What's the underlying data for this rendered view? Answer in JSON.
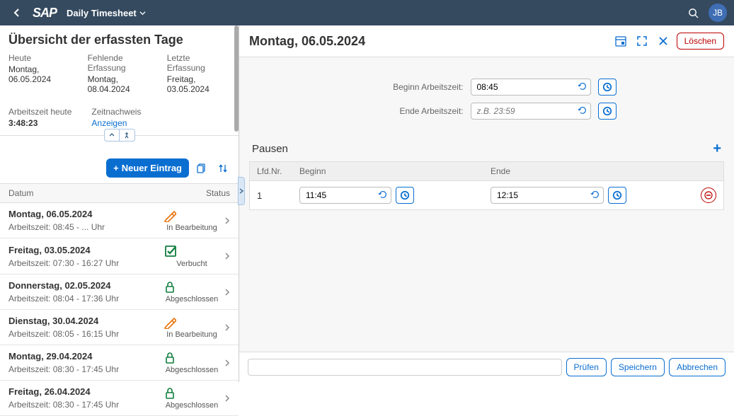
{
  "header": {
    "app_title": "Daily Timesheet",
    "avatar": "JB"
  },
  "overview": {
    "title": "Übersicht der erfassten Tage",
    "today_label": "Heute",
    "today_value": "Montag, 06.05.2024",
    "missing_label": "Fehlende Erfassung",
    "missing_value": "Montag, 08.04.2024",
    "last_label": "Letzte Erfassung",
    "last_value": "Freitag, 03.05.2024",
    "work_today_label": "Arbeitszeit heute",
    "work_today_value": "3:48:23",
    "proof_label": "Zeitnachweis",
    "proof_link": "Anzeigen"
  },
  "toolbar": {
    "new_entry": "Neuer Eintrag"
  },
  "list_header": {
    "date": "Datum",
    "status": "Status"
  },
  "status_labels": {
    "in_bearbeitung": "In Bearbeitung",
    "verbucht": "Verbucht",
    "abgeschlossen": "Abgeschlossen"
  },
  "entries": [
    {
      "date": "Montag, 06.05.2024",
      "sub": "Arbeitszeit: 08:45 - ... Uhr",
      "status": "in_bearbeitung"
    },
    {
      "date": "Freitag, 03.05.2024",
      "sub": "Arbeitszeit: 07:30 - 16:27 Uhr",
      "status": "verbucht"
    },
    {
      "date": "Donnerstag, 02.05.2024",
      "sub": "Arbeitszeit: 08:04 - 17:36 Uhr",
      "status": "abgeschlossen"
    },
    {
      "date": "Dienstag, 30.04.2024",
      "sub": "Arbeitszeit: 08:05 - 16:15 Uhr",
      "status": "in_bearbeitung"
    },
    {
      "date": "Montag, 29.04.2024",
      "sub": "Arbeitszeit: 08:30 - 17:45 Uhr",
      "status": "abgeschlossen"
    },
    {
      "date": "Freitag, 26.04.2024",
      "sub": "Arbeitszeit: 08:30 - 17:45 Uhr",
      "status": "abgeschlossen"
    }
  ],
  "detail": {
    "title": "Montag, 06.05.2024",
    "delete": "Löschen",
    "begin_label": "Beginn Arbeitszeit:",
    "begin_value": "08:45",
    "end_label": "Ende Arbeitszeit:",
    "end_placeholder": "z.B. 23:59",
    "pausen_title": "Pausen",
    "ph_lfdnr": "Lfd.Nr.",
    "ph_beginn": "Beginn",
    "ph_ende": "Ende",
    "pause": {
      "nr": "1",
      "beginn": "11:45",
      "ende": "12:15"
    }
  },
  "footer": {
    "check": "Prüfen",
    "save": "Speichern",
    "cancel": "Abbrechen"
  }
}
